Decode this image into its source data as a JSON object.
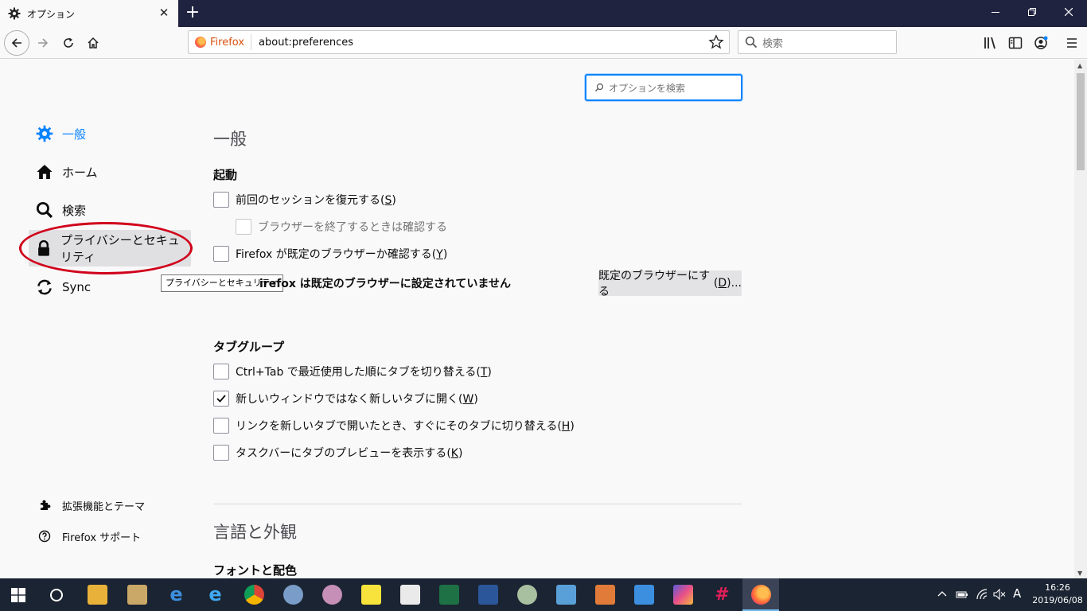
{
  "window": {
    "tab_title": "オプション",
    "tab_close": "✕",
    "new_tab": "+"
  },
  "navbar": {
    "identity_label": "Firefox",
    "url": "about:preferences",
    "search_placeholder": "検索"
  },
  "prefs": {
    "search_placeholder": "オプションを検索",
    "categories": [
      {
        "label": "一般",
        "icon": "gear-icon",
        "selected": true
      },
      {
        "label": "ホーム",
        "icon": "home-icon"
      },
      {
        "label": "検索",
        "icon": "search-icon"
      },
      {
        "label": "プライバシーとセキュリティ",
        "icon": "lock-icon",
        "hovered": true
      },
      {
        "label": "Sync",
        "icon": "sync-icon"
      }
    ],
    "tooltip": "プライバシーとセキュリティ",
    "footer": [
      {
        "label": "拡張機能とテーマ",
        "icon": "puzzle-icon"
      },
      {
        "label": "Firefox サポート",
        "icon": "help-icon"
      }
    ],
    "general_title": "一般",
    "startup_title": "起動",
    "startup": {
      "restore_session": {
        "label": "前回のセッションを復元する",
        "key": "S",
        "checked": false
      },
      "warn_quit": {
        "label": "ブラウザーを終了するときは確認する",
        "checked": false,
        "disabled": true
      },
      "check_default": {
        "label": "Firefox が既定のブラウザーか確認する",
        "key": "Y",
        "checked": false
      },
      "default_status": "Firefox は既定のブラウザーに設定されていません",
      "default_status_visible": "irefox は既定のブラウザーに設定されていません",
      "make_default_button": "既定のブラウザーにする",
      "make_default_key": "D",
      "make_default_suffix": "..."
    },
    "tabs_title": "タブグループ",
    "tabs": [
      {
        "label": "Ctrl+Tab で最近使用した順にタブを切り替える",
        "key": "T",
        "checked": false
      },
      {
        "label": "新しいウィンドウではなく新しいタブに開く",
        "key": "W",
        "checked": true
      },
      {
        "label": "リンクを新しいタブで開いたとき、すぐにそのタブに切り替える",
        "key": "H",
        "checked": false
      },
      {
        "label": "タスクバーにタブのプレビューを表示する",
        "key": "K",
        "checked": false
      }
    ],
    "language_title": "言語と外観",
    "fonts_title": "フォントと配色"
  },
  "taskbar": {
    "time": "16:26",
    "date": "2019/06/08",
    "ime": "A"
  },
  "colors": {
    "accent": "#0a84ff",
    "annotation": "#d0021b",
    "titlebar": "#202340",
    "taskbar": "#1b2432"
  }
}
